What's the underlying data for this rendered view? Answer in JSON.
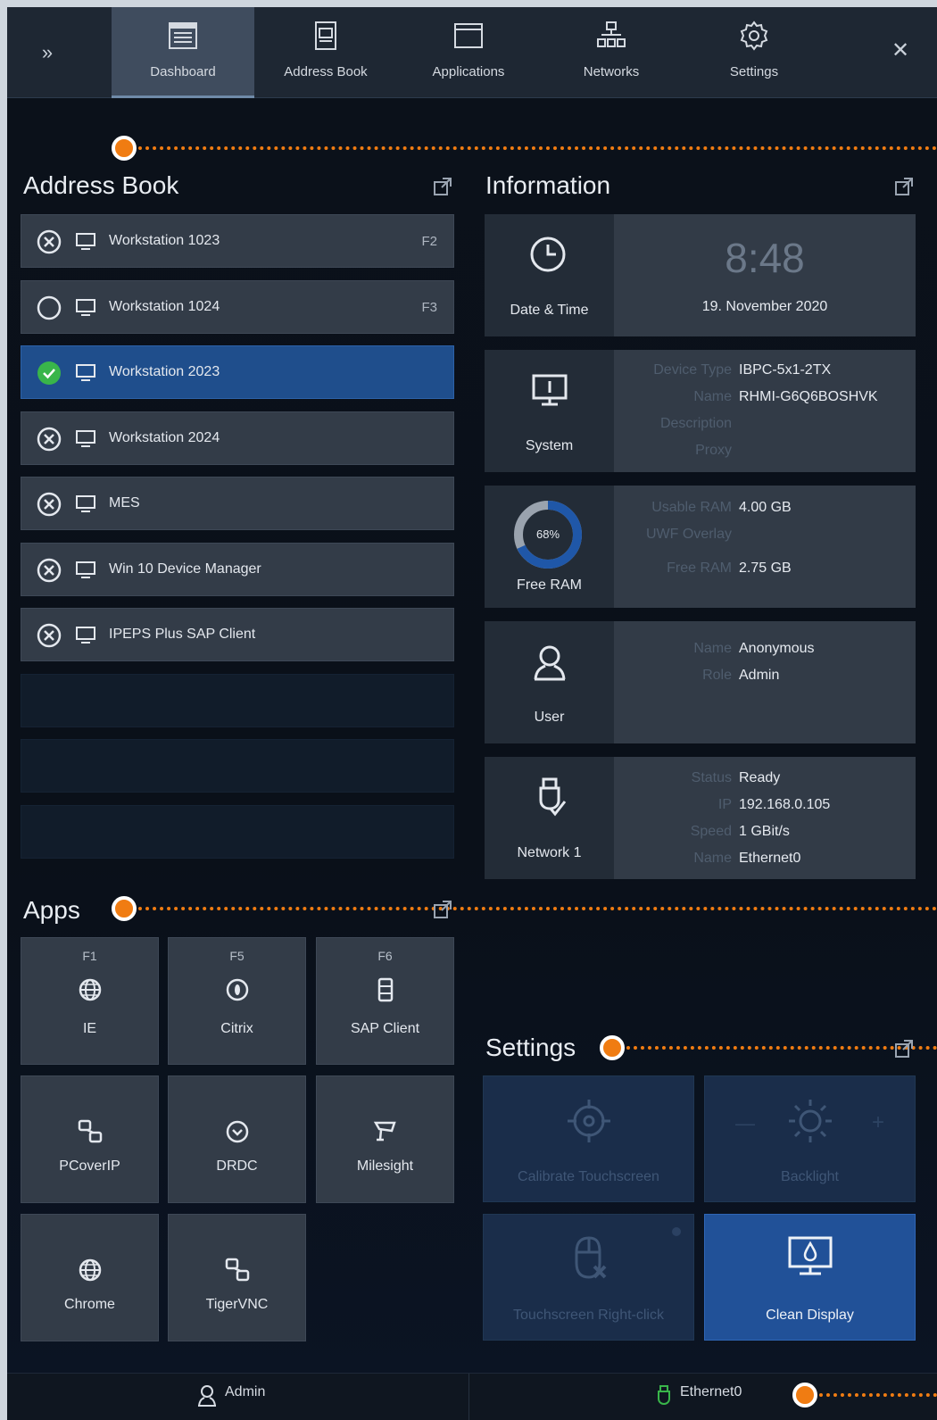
{
  "tabs": [
    {
      "label": "Dashboard",
      "icon": "dashboard-icon",
      "active": true
    },
    {
      "label": "Address Book",
      "icon": "address-book-icon"
    },
    {
      "label": "Applications",
      "icon": "applications-icon"
    },
    {
      "label": "Networks",
      "icon": "networks-icon"
    },
    {
      "label": "Settings",
      "icon": "settings-gear-icon"
    }
  ],
  "address_book": {
    "title": "Address Book",
    "items": [
      {
        "name": "Workstation 1023",
        "key": "F2",
        "state": "error"
      },
      {
        "name": "Workstation 1024",
        "key": "F3",
        "state": "idle"
      },
      {
        "name": "Workstation 2023",
        "key": "",
        "state": "connected"
      },
      {
        "name": "Workstation 2024",
        "key": "",
        "state": "error"
      },
      {
        "name": "MES",
        "key": "",
        "state": "error"
      },
      {
        "name": "Win 10 Device Manager",
        "key": "",
        "state": "error"
      },
      {
        "name": "IPEPS Plus SAP Client",
        "key": "",
        "state": "error"
      }
    ]
  },
  "information": {
    "title": "Information",
    "datetime": {
      "caption": "Date & Time",
      "time": "8:48",
      "date": "19. November 2020"
    },
    "system": {
      "caption": "System",
      "device_type_label": "Device Type",
      "device_type": "IBPC-5x1-2TX",
      "name_label": "Name",
      "name": "RHMI-G6Q6BOSHVK",
      "description_label": "Description",
      "proxy_label": "Proxy"
    },
    "ram": {
      "caption": "Free RAM",
      "percent_label": "68%",
      "percent": 68,
      "usable_label": "Usable RAM",
      "usable": "4.00 GB",
      "uwf_label": "UWF Overlay",
      "free_label": "Free RAM",
      "free": "2.75 GB"
    },
    "user": {
      "caption": "User",
      "name_label": "Name",
      "name": "Anonymous",
      "role_label": "Role",
      "role": "Admin"
    },
    "network": {
      "caption": "Network 1",
      "status_label": "Status",
      "status": "Ready",
      "ip_label": "IP",
      "ip": "192.168.0.105",
      "speed_label": "Speed",
      "speed": "1 GBit/s",
      "name_label": "Name",
      "name": "Ethernet0"
    }
  },
  "apps": {
    "title": "Apps",
    "items": [
      {
        "key": "F1",
        "name": "IE",
        "icon": "globe-icon"
      },
      {
        "key": "F5",
        "name": "Citrix",
        "icon": "citrix-icon"
      },
      {
        "key": "F6",
        "name": "SAP Client",
        "icon": "sap-client-icon"
      },
      {
        "key": "",
        "name": "PCoverIP",
        "icon": "pcoip-icon"
      },
      {
        "key": "",
        "name": "DRDC",
        "icon": "drdc-icon"
      },
      {
        "key": "",
        "name": "Milesight",
        "icon": "camera-icon"
      },
      {
        "key": "",
        "name": "Chrome",
        "icon": "globe-icon"
      },
      {
        "key": "",
        "name": "TigerVNC",
        "icon": "vnc-icon"
      }
    ]
  },
  "settings": {
    "title": "Settings",
    "items": [
      {
        "name": "Calibrate Touchscreen",
        "icon": "crosshair-icon",
        "active": false
      },
      {
        "name": "Backlight",
        "icon": "brightness-icon",
        "active": false,
        "minus": "—",
        "plus": "+"
      },
      {
        "name": "Touchscreen Right-click",
        "icon": "mouse-right-click-icon",
        "active": false
      },
      {
        "name": "Clean Display",
        "icon": "clean-display-icon",
        "active": true
      }
    ]
  },
  "statusbar": {
    "user": "Admin",
    "network": "Ethernet0"
  },
  "colors": {
    "accent": "#215198",
    "callout": "#f07c12",
    "ok": "#39b54a"
  }
}
